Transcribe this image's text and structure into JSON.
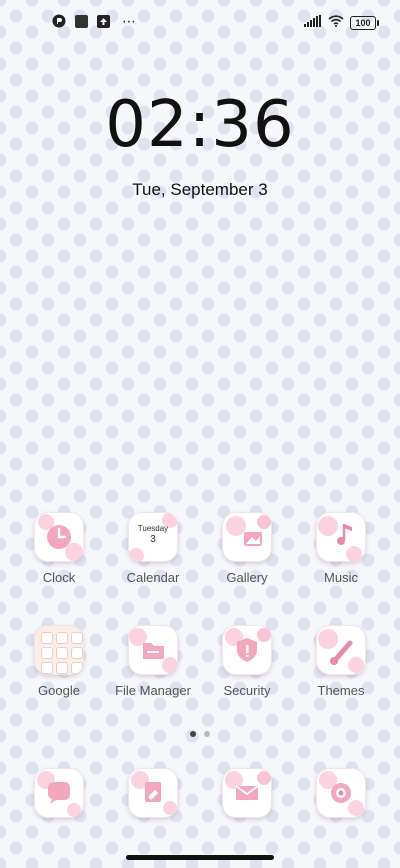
{
  "status_bar": {
    "left_icons": [
      "app-notification-icon",
      "square-notification-icon",
      "upload-notification-icon"
    ],
    "overflow": "⋯",
    "battery": "100"
  },
  "lockscreen": {
    "time": "02:36",
    "date": "Tue, September 3"
  },
  "apps_row1": [
    {
      "label": "Clock"
    },
    {
      "label": "Calendar",
      "weekday": "Tuesday",
      "day": "3"
    },
    {
      "label": "Gallery"
    },
    {
      "label": "Music"
    }
  ],
  "apps_row2": [
    {
      "label": "Google"
    },
    {
      "label": "File Manager"
    },
    {
      "label": "Security"
    },
    {
      "label": "Themes"
    }
  ],
  "dock_icons": [
    "message-icon",
    "notes-icon",
    "mail-icon",
    "camera-icon"
  ],
  "pager": {
    "pages": 2,
    "active": 1
  },
  "colors": {
    "pink_accent": "#f2a7bf",
    "background": "#f6f7fb"
  }
}
